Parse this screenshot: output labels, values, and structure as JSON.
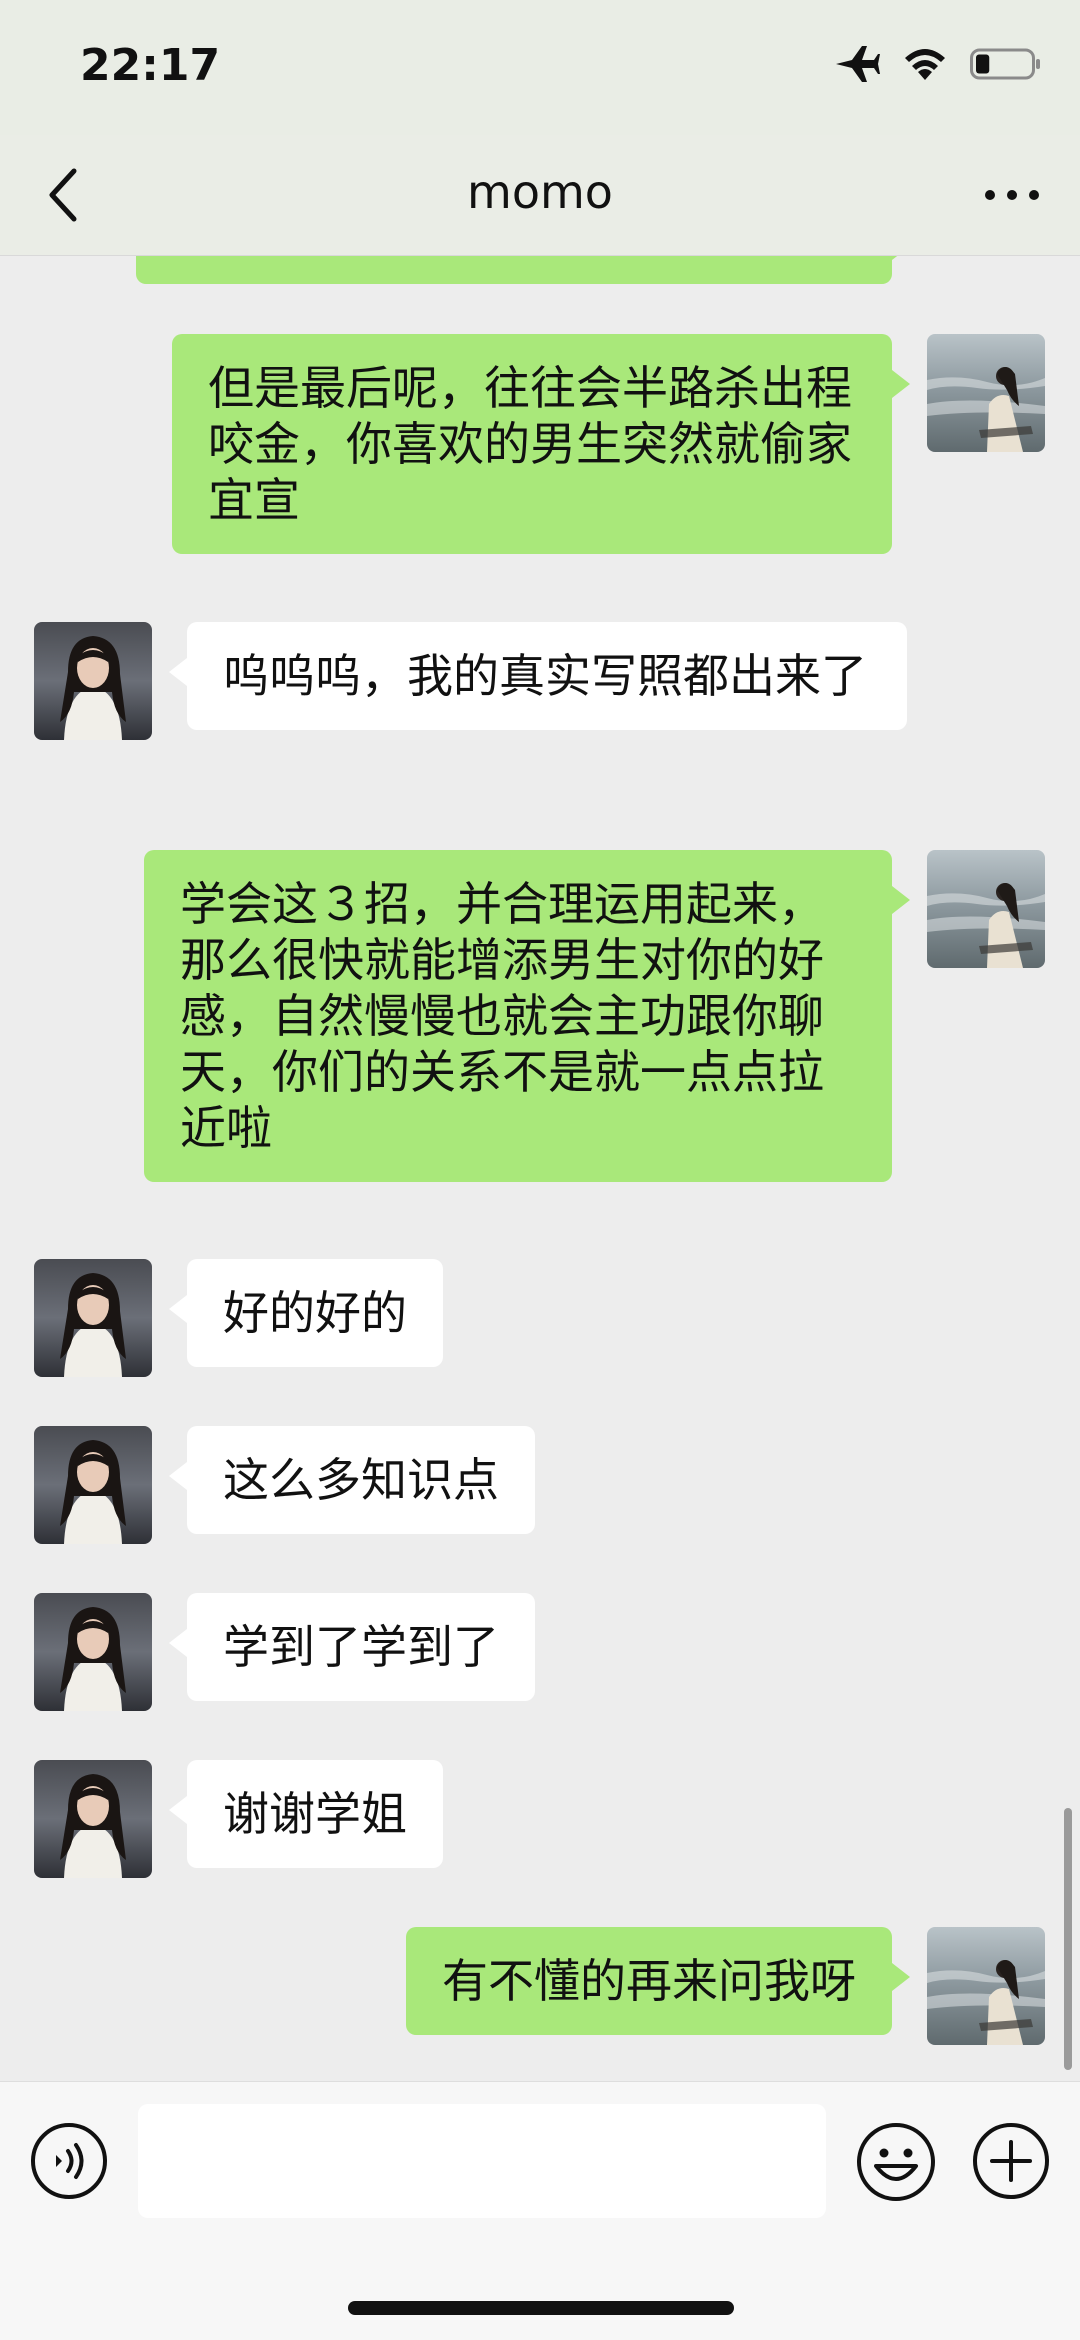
{
  "status_bar": {
    "time": "22:17",
    "battery_level": 0.25
  },
  "header": {
    "title": "momo"
  },
  "messages": [
    {
      "side": "me",
      "text": ""
    },
    {
      "side": "me",
      "text": "但是最后呢，往往会半路杀出程咬金，你喜欢的男生突然就偷家宜宣"
    },
    {
      "side": "other",
      "text": "呜呜呜，我的真实写照都出来了"
    },
    {
      "side": "me",
      "text": "学会这３招，并合理运用起来，那么很快就能增添男生对你的好感，自然慢慢也就会主功跟你聊天，你们的关系不是就一点点拉近啦"
    },
    {
      "side": "other",
      "text": "好的好的"
    },
    {
      "side": "other",
      "text": "这么多知识点"
    },
    {
      "side": "other",
      "text": "学到了学到了"
    },
    {
      "side": "other",
      "text": "谢谢学姐"
    },
    {
      "side": "me",
      "text": "有不懂的再来问我呀"
    }
  ],
  "input": {
    "value": "",
    "placeholder": ""
  },
  "colors": {
    "my_bubble": "#a9e87a",
    "other_bubble": "#ffffff",
    "background": "#ededed"
  },
  "icons": {
    "back": "chevron-left-icon",
    "more": "more-dots-icon",
    "voice": "voice-icon",
    "emoji": "emoji-icon",
    "plus": "plus-icon"
  }
}
